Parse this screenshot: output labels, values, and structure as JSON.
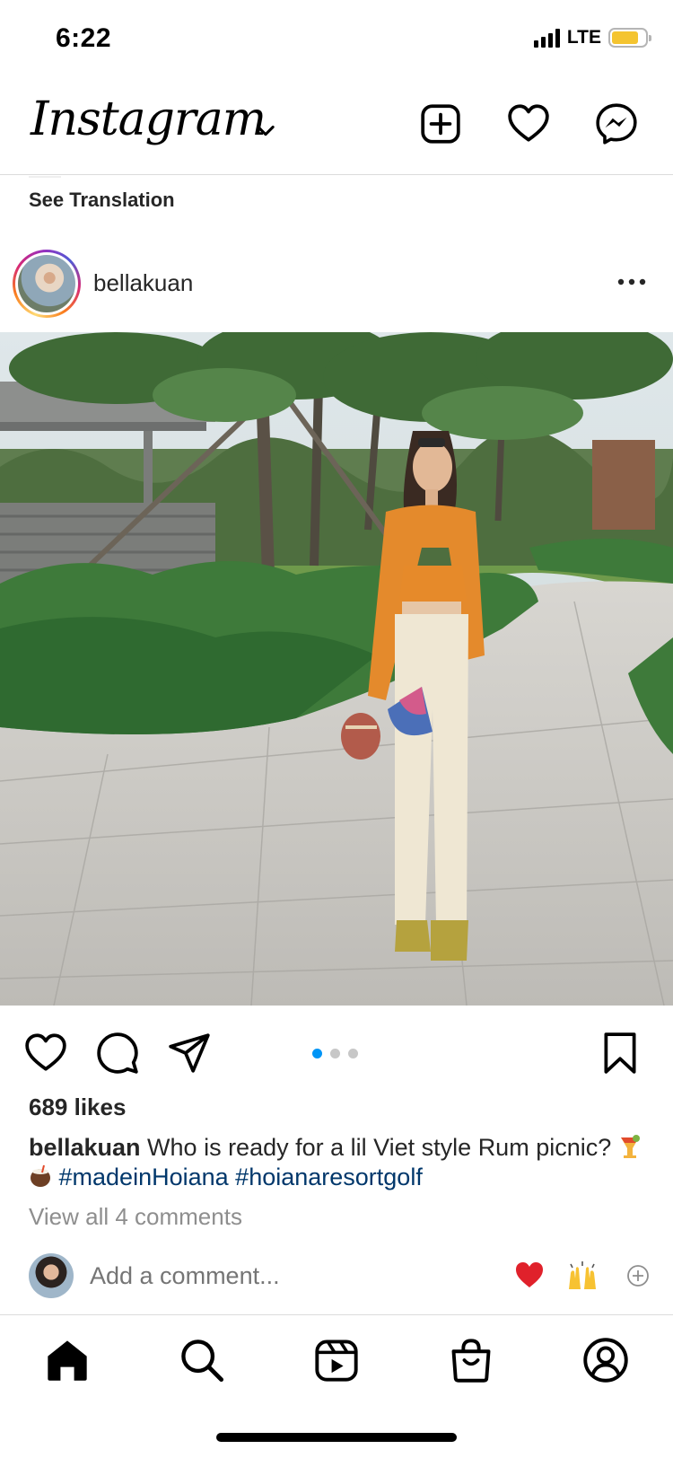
{
  "status_bar": {
    "time": "6:22",
    "network": "LTE",
    "battery_color": "#f4c430"
  },
  "header": {
    "logo": "Instagram",
    "icons": [
      "new-post-icon",
      "heart-icon",
      "messenger-icon"
    ]
  },
  "feed": {
    "see_translation": "See Translation"
  },
  "post": {
    "username": "bellakuan",
    "carousel": {
      "count": 3,
      "active": 1
    },
    "likes": "689 likes",
    "caption": {
      "username": "bellakuan",
      "text": " Who is ready for a lil Viet style Rum picnic? ",
      "emoji_1": "🍹",
      "emoji_2": "🥥",
      "hashtag_1": "#madeinHoiana",
      "hashtag_2": "#hoianaresortgolf"
    },
    "view_comments": "View all 4 comments",
    "comment_placeholder": "Add a comment...",
    "quick_reactions": [
      "❤️",
      "🙌"
    ]
  },
  "tab_bar": {
    "items": [
      "home",
      "search",
      "reels",
      "shop",
      "profile"
    ]
  },
  "colors": {
    "link": "#00376b",
    "accent": "#0095f6",
    "muted": "#8e8e8e",
    "divider": "#dbdbdb"
  }
}
